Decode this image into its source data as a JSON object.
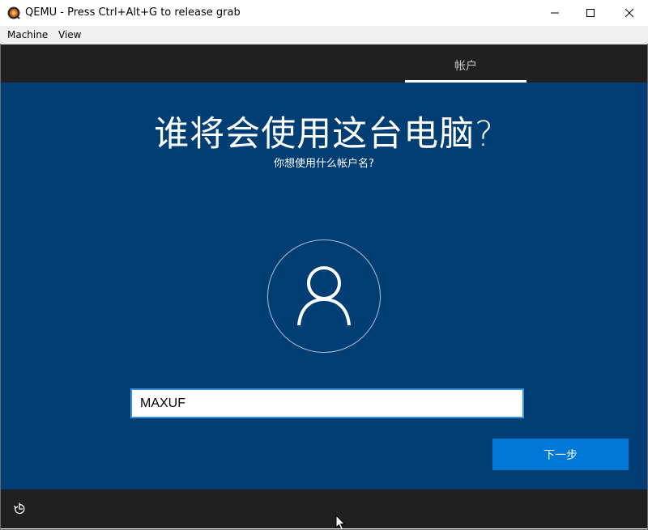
{
  "window": {
    "title": "QEMU - Press Ctrl+Alt+G to release grab",
    "icon": "qemu-logo-icon",
    "controls": [
      "minimize-icon",
      "maximize-icon",
      "close-icon"
    ]
  },
  "menubar": {
    "items": [
      {
        "label": "Machine"
      },
      {
        "label": "View"
      }
    ]
  },
  "oobe": {
    "tab_label": "帐户",
    "heading": "谁将会使用这台电脑?",
    "subheading": "你想使用什么帐户名?",
    "avatar_icon": "user-icon",
    "username_value": "MAXUF",
    "next_label": "下一步",
    "ease_of_access_icon": "ease-of-access-icon"
  },
  "colors": {
    "background": "#003e74",
    "bar": "#202020",
    "accent": "#0078d7"
  }
}
